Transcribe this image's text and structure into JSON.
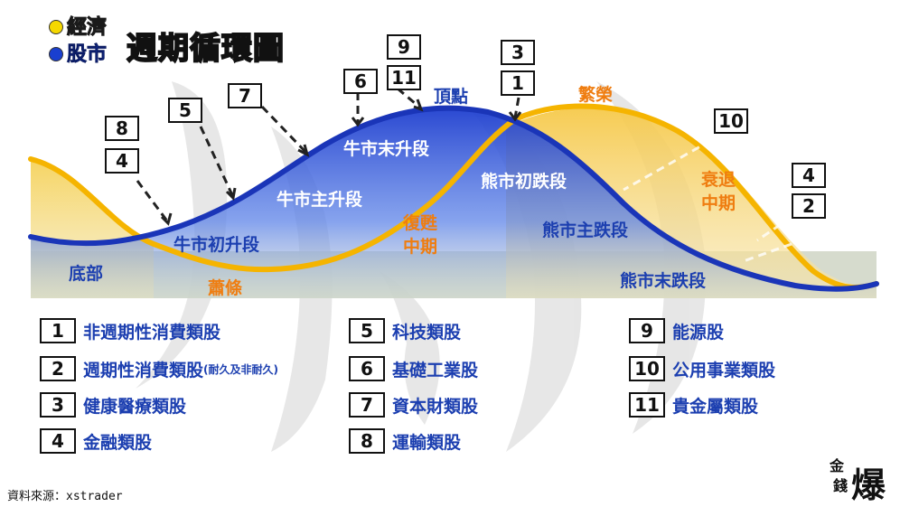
{
  "legend": {
    "economy": "經濟",
    "stock": "股市",
    "economy_color": "#f5d800",
    "stock_color": "#1a3fd0"
  },
  "title": "週期循環圖",
  "phases": {
    "bottom": "底部",
    "bull_early": "牛市初升段",
    "bull_main": "牛市主升段",
    "bull_late": "牛市末升段",
    "top": "頂點",
    "bear_early": "熊市初跌段",
    "bear_main": "熊市主跌段",
    "bear_late": "熊市末跌段",
    "depression": "蕭條",
    "recovery_l1": "復甦",
    "recovery_l2": "中期",
    "boom": "繁榮",
    "recession_l1": "衰退",
    "recession_l2": "中期"
  },
  "markers": {
    "m8": "8",
    "m4a": "4",
    "m5": "5",
    "m7": "7",
    "m6": "6",
    "m9": "9",
    "m11": "11",
    "m3": "3",
    "m1": "1",
    "m10": "10",
    "m4b": "4",
    "m2": "2"
  },
  "sectors": [
    {
      "num": "1",
      "label": "非週期性消費類股",
      "note": ""
    },
    {
      "num": "2",
      "label": "週期性消費類股",
      "note": "(耐久及非耐久)"
    },
    {
      "num": "3",
      "label": "健康醫療類股",
      "note": ""
    },
    {
      "num": "4",
      "label": "金融類股",
      "note": ""
    },
    {
      "num": "5",
      "label": "科技類股",
      "note": ""
    },
    {
      "num": "6",
      "label": "基礎工業股",
      "note": ""
    },
    {
      "num": "7",
      "label": "資本財類股",
      "note": ""
    },
    {
      "num": "8",
      "label": "運輸類股",
      "note": ""
    },
    {
      "num": "9",
      "label": "能源股",
      "note": ""
    },
    {
      "num": "10",
      "label": "公用事業類股",
      "note": ""
    },
    {
      "num": "11",
      "label": "貴金屬類股",
      "note": ""
    }
  ],
  "source": "資料來源：xstrader",
  "logo_l1": "金",
  "logo_l2": "錢",
  "logo_big": "爆",
  "colors": {
    "stock_curve": "#1a35b8",
    "economy_curve": "#f5b400",
    "fill_blue": "#2a50d0",
    "fill_yellow": "#f7d36a",
    "ground": "#cfd5c4"
  }
}
